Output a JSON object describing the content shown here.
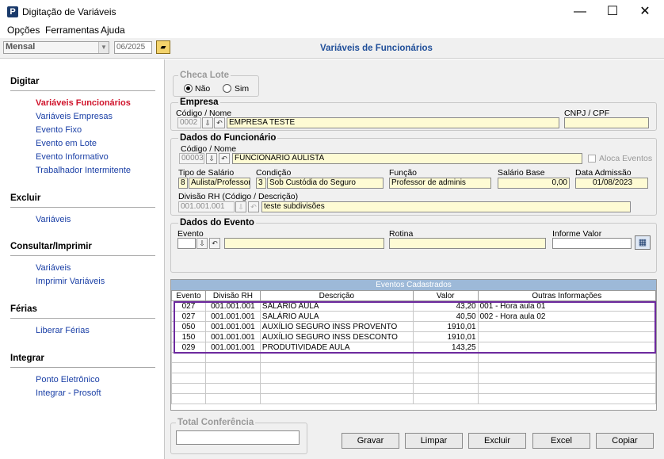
{
  "window": {
    "title": "Digitação de Variáveis",
    "icon_letter": "P",
    "minimize": "—",
    "maximize": "☐",
    "close": "✕"
  },
  "menu": [
    "Opções",
    "Ferramentas",
    "Ajuda"
  ],
  "toolbar": {
    "period_type": "Mensal",
    "period_value": "06/2025",
    "main_title": "Variáveis de Funcionários"
  },
  "sidebar": {
    "sections": [
      {
        "title": "Digitar",
        "items": [
          "Variáveis Funcionários",
          "Variáveis Empresas",
          "Evento Fixo",
          "Evento em Lote",
          "Evento Informativo",
          "Trabalhador Intermitente"
        ]
      },
      {
        "title": "Excluir",
        "items": [
          "Variáveis"
        ]
      },
      {
        "title": "Consultar/Imprimir",
        "items": [
          "Variáveis",
          "Imprimir Variáveis"
        ]
      },
      {
        "title": "Férias",
        "items": [
          "Liberar Férias"
        ]
      },
      {
        "title": "Integrar",
        "items": [
          "Ponto Eletrônico",
          "Integrar - Prosoft"
        ]
      }
    ]
  },
  "checa_lote": {
    "title": "Checa Lote",
    "nao": "Não",
    "sim": "Sim"
  },
  "empresa": {
    "title": "Empresa",
    "codigo_label": "Código / Nome",
    "codigo": "0002",
    "nome": "EMPRESA TESTE",
    "cnpj_label": "CNPJ / CPF",
    "cnpj": ""
  },
  "funcionario": {
    "title": "Dados do Funcionário",
    "codigo_label": "Código / Nome",
    "codigo": "00003",
    "nome": "FUNCIONARIO  AULISTA",
    "aloca_label": "Aloca Eventos",
    "tipo_label": "Tipo de Salário",
    "tipo_code": "8",
    "tipo_desc": "Aulista/Professor",
    "condicao_label": "Condição",
    "condicao_code": "3",
    "condicao_desc": "Sob Custódia do Seguro",
    "funcao_label": "Função",
    "funcao": "Professor de adminis",
    "salario_label": "Salário Base",
    "salario": "0,00",
    "admissao_label": "Data Admissão",
    "admissao": "01/08/2023",
    "divisao_label": "Divisão RH (Código / Descrição)",
    "divisao_code": "001.001.001",
    "divisao_desc": "teste subdivisões"
  },
  "evento": {
    "title": "Dados do Evento",
    "evento_label": "Evento",
    "rotina_label": "Rotina",
    "informe_label": "Informe Valor"
  },
  "table": {
    "caption": "Eventos Cadastrados",
    "headers": [
      "Evento",
      "Divisão RH",
      "Descrição",
      "Valor",
      "Outras Informações"
    ],
    "rows": [
      [
        "027",
        "001.001.001",
        "SALÁRIO AULA",
        "43,20",
        "001 - Hora aula 01"
      ],
      [
        "027",
        "001.001.001",
        "SALÁRIO AULA",
        "40,50",
        "002 - Hora aula 02"
      ],
      [
        "050",
        "001.001.001",
        "AUXÍLIO SEGURO  INSS PROVENTO",
        "1910,01",
        ""
      ],
      [
        "150",
        "001.001.001",
        "AUXÍLIO SEGURO  INSS DESCONTO",
        "1910,01",
        ""
      ],
      [
        "029",
        "001.001.001",
        "PRODUTIVIDADE AULA",
        "143,25",
        ""
      ]
    ]
  },
  "total": {
    "title": "Total Conferência",
    "value": ""
  },
  "buttons": {
    "gravar": "Gravar",
    "limpar": "Limpar",
    "excluir": "Excluir",
    "excel": "Excel",
    "copiar": "Copiar"
  },
  "colors": {
    "accent_title": "#1f4e99",
    "active_link": "#d0142c",
    "link": "#1a3fa6",
    "field_yellow": "#fefbd4",
    "selection": "#6d2a9e",
    "table_caption": "#9db9d8"
  }
}
